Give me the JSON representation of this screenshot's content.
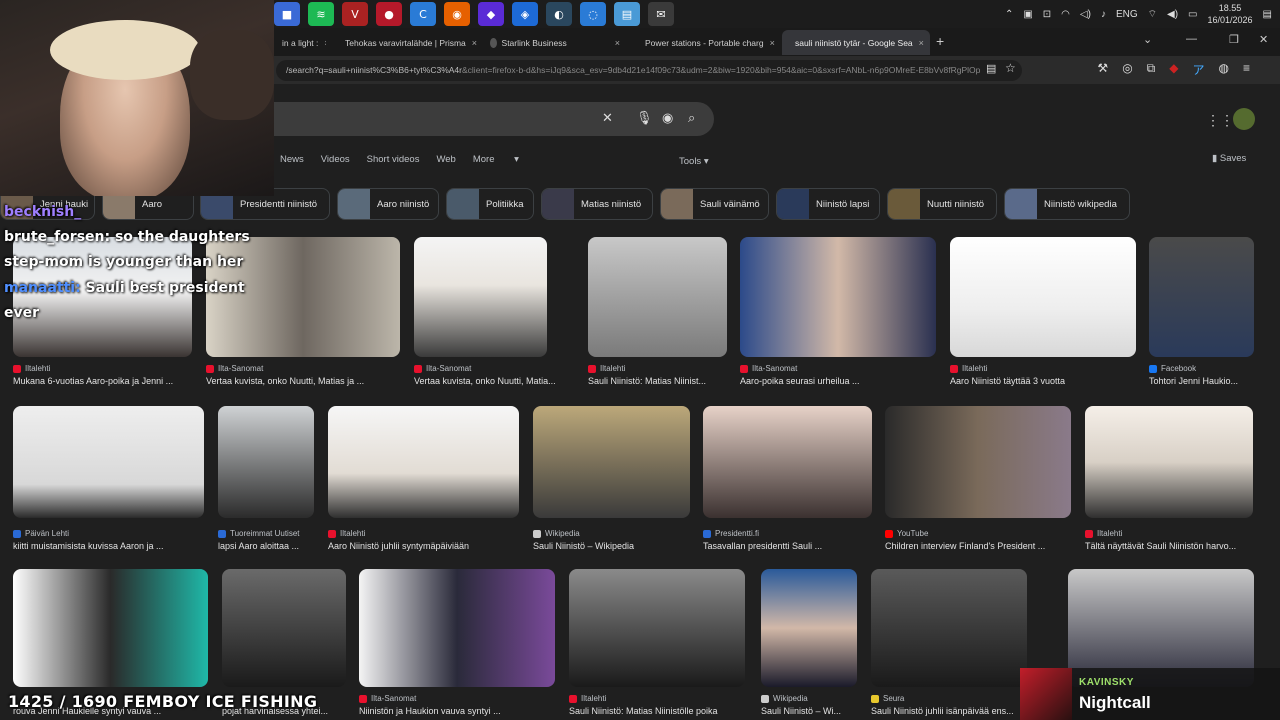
{
  "taskbar": {
    "apps": [
      {
        "icon": "generic-app-icon",
        "color": "#3a6ad6",
        "glyph": "■"
      },
      {
        "icon": "spotify-icon",
        "color": "#1db954",
        "glyph": "≋"
      },
      {
        "icon": "vencord-icon",
        "color": "#aa2222",
        "glyph": "V"
      },
      {
        "icon": "recorder-icon",
        "color": "#b5192a",
        "glyph": "●"
      },
      {
        "icon": "ccleaner-icon",
        "color": "#2a7bd6",
        "glyph": "C"
      },
      {
        "icon": "firefox-icon",
        "color": "#e66000",
        "glyph": "◉"
      },
      {
        "icon": "game-launcher-icon",
        "color": "#5a2bd6",
        "glyph": "◆"
      },
      {
        "icon": "blue-app-icon",
        "color": "#1d6ad6",
        "glyph": "◈"
      },
      {
        "icon": "steam-icon",
        "color": "#2a475e",
        "glyph": "◐"
      },
      {
        "icon": "browser-icon",
        "color": "#2a7bd6",
        "glyph": "◌"
      },
      {
        "icon": "notes-app-icon",
        "color": "#4a9ad6",
        "glyph": "▤"
      },
      {
        "icon": "chat-app-icon",
        "color": "#3a3a3a",
        "glyph": "✉"
      }
    ],
    "lang": "ENG",
    "time": "18.55",
    "date": "16/01/2026"
  },
  "browser": {
    "tabs": [
      {
        "title": "in a light :",
        "fav": "#999999",
        "active": false
      },
      {
        "title": "Tehokas varavirtalähde | Prisma",
        "fav": "#e85a1e",
        "active": false
      },
      {
        "title": "Starlink Business",
        "fav": "#555555",
        "active": false
      },
      {
        "title": "Power stations - Portable charg",
        "fav": "#44aa44",
        "active": false
      },
      {
        "title": "sauli niinistö tytär - Google Sea",
        "fav": "#4285f4",
        "active": true
      }
    ],
    "url_host": "/search?q=sauli+niinist%C3%B6+tyt%C3%A4r",
    "url_rest": "&client=firefox-b-d&hs=iJq9&sca_esv=9db4d21e14f09c73&udm=2&biw=1920&bih=954&aic=0&sxsrf=ANbL-n6p9OMreE-E8bVv8fRgPlOp"
  },
  "search": {
    "nav": [
      "News",
      "Videos",
      "Short videos",
      "Web",
      "More"
    ],
    "tools": "Tools",
    "saves": "Saves"
  },
  "chips": [
    {
      "label": "Jenni hauki",
      "color": "#6a5a4a"
    },
    {
      "label": "Aaro",
      "color": "#8a7a6a"
    },
    {
      "label": "Presidentti niinistö",
      "color": "#3a4a6a"
    },
    {
      "label": "Aaro niinistö",
      "color": "#5a6a7a"
    },
    {
      "label": "Politiikka",
      "color": "#4a5a6a"
    },
    {
      "label": "Matias niinistö",
      "color": "#3a3a4a"
    },
    {
      "label": "Sauli väinämö",
      "color": "#7a6a5a"
    },
    {
      "label": "Niinistö lapsi",
      "color": "#2a3a5a"
    },
    {
      "label": "Nuutti niinistö",
      "color": "#6a5a3a"
    },
    {
      "label": "Niinistö wikipedia",
      "color": "#5a6a8a"
    }
  ],
  "rows": [
    [
      {
        "source": "Iltalehti",
        "fav": "#e8112d",
        "caption": "Mukana 6-vuotias Aaro-poika ja Jenni ...",
        "bg": "linear-gradient(180deg,#d8dde2 0%,#f2f2f2 45%,#3a3432 100%)"
      },
      {
        "source": "Ilta-Sanomat",
        "fav": "#e8112d",
        "caption": "Vertaa kuvista, onko Nuutti, Matias ja ...",
        "bg": "linear-gradient(90deg,#d9d3c6,#6e6760,#bcb6aa)"
      },
      {
        "source": "Ilta-Sanomat",
        "fav": "#e8112d",
        "caption": "Vertaa kuvista, onko Nuutti, Matia...",
        "bg": "linear-gradient(180deg,#f4f4f4 0%,#e9e5df 40%,#3a3a3a 100%)"
      },
      {
        "source": "Iltalehti",
        "fav": "#e8112d",
        "caption": "Sauli Niinistö: Matias Niinist...",
        "bg": "linear-gradient(180deg,#c8c8c8,#7a7a7a)"
      },
      {
        "source": "Ilta-Sanomat",
        "fav": "#e8112d",
        "caption": "Aaro-poika seurasi urheilua ...",
        "bg": "linear-gradient(90deg,#2c4a8a,#d2b9a8,#2a3050)"
      },
      {
        "source": "Iltalehti",
        "fav": "#e8112d",
        "caption": "Aaro Niinistö täyttää 3 vuotta",
        "bg": "linear-gradient(180deg,#ffffff 0%,#eeeeee 60%,#d8d8d8 100%)"
      },
      {
        "source": "Facebook",
        "fav": "#1877f2",
        "caption": "Tohtori Jenni Haukio...",
        "bg": "linear-gradient(180deg,#4a4a4a,#2a3a5a)"
      }
    ],
    [
      {
        "source": "Päivän Lehti",
        "fav": "#2a6ad6",
        "caption": "kiitti muistamisista kuvissa Aaron ja ...",
        "bg": "linear-gradient(180deg,#eeeeee,#d8d8d8 70%,#2a2a2a)"
      },
      {
        "source": "Tuoreimmat Uutiset",
        "fav": "#2a6ad6",
        "caption": "lapsi Aaro aloittaa ...",
        "bg": "linear-gradient(180deg,#cfd2d4,#2b2b2b)"
      },
      {
        "source": "Iltalehti",
        "fav": "#e8112d",
        "caption": "Aaro Niinistö juhlii syntymäpäiviään",
        "bg": "linear-gradient(180deg,#f6f6f6,#e2dcd4 60%,#2f2f2f)"
      },
      {
        "source": "Wikipedia",
        "fav": "#cccccc",
        "caption": "Sauli Niinistö – Wikipedia",
        "bg": "linear-gradient(180deg,#bca87a,#3a3a3a)"
      },
      {
        "source": "Presidentti.fi",
        "fav": "#2a6ad6",
        "caption": "Tasavallan presidentti Sauli ...",
        "bg": "linear-gradient(180deg,#e7d2c8,#3b3130)"
      },
      {
        "source": "YouTube",
        "fav": "#ff0000",
        "caption": "Children interview Finland's President ...",
        "bg": "linear-gradient(90deg,#2a2a2a,#7a6a5a,#8a7a8a)"
      },
      {
        "source": "Iltalehti",
        "fav": "#e8112d",
        "caption": "Tältä näyttävät Sauli Niinistön harvo...",
        "bg": "linear-gradient(180deg,#f5efe8,#d8d0c6 50%,#2f2f2f)"
      }
    ],
    [
      {
        "source": "",
        "fav": "#1f1f1f",
        "caption": "rouva Jenni Haukielle syntyi vauva ...",
        "bg": "linear-gradient(90deg,#ffffff,#2a2a2a,#1fb8a8)"
      },
      {
        "source": "",
        "fav": "#1f1f1f",
        "caption": "pojat harvinaisessa yhtei...",
        "bg": "linear-gradient(180deg,#6a6a6a,#1a1a1a)"
      },
      {
        "source": "Ilta-Sanomat",
        "fav": "#e8112d",
        "caption": "Niinistön ja Haukion vauva syntyi ...",
        "bg": "linear-gradient(90deg,#f4f4f4,#2a2a3a,#7a4a9a)"
      },
      {
        "source": "Iltalehti",
        "fav": "#e8112d",
        "caption": "Sauli Niinistö: Matias Niinistölle poika",
        "bg": "linear-gradient(180deg,#8a8a8a,#1a1a1a)"
      },
      {
        "source": "Wikipedia",
        "fav": "#cccccc",
        "caption": "Sauli Niinistö – Wi...",
        "bg": "linear-gradient(180deg,#2a5a9a,#d2b8a8,#1a1a2a)"
      },
      {
        "source": "Seura",
        "fav": "#e8c82d",
        "caption": "Sauli Niinistö juhlii isänpäivää ens...",
        "bg": "linear-gradient(180deg,#5a5a5a,#1a1a1a)"
      },
      {
        "source": "",
        "fav": "#1f1f1f",
        "caption": "",
        "bg": "linear-gradient(180deg,#c8c8c8,#2a2a3a)"
      }
    ]
  ],
  "overlay": {
    "chat": [
      {
        "user": "becknish_",
        "msg": "",
        "color": "purple"
      },
      {
        "user": "brute_forsen:",
        "msg": " so the daughters",
        "color": "white"
      },
      {
        "user": "",
        "msg": "step-mom is younger than her",
        "color": "white"
      },
      {
        "user": "manaatti:",
        "msg": " Sauli best president",
        "color": "blue"
      },
      {
        "user": "",
        "msg": "ever",
        "color": "white"
      }
    ],
    "counter": "1425 / 1690 FEMBOY ICE FISHING",
    "now_playing_artist": "KAVINSKY",
    "now_playing_track": "Nightcall"
  },
  "colors": {
    "bg": "#1f1f1f",
    "text": "#e3e3e3",
    "muted": "#bdc1c6"
  }
}
